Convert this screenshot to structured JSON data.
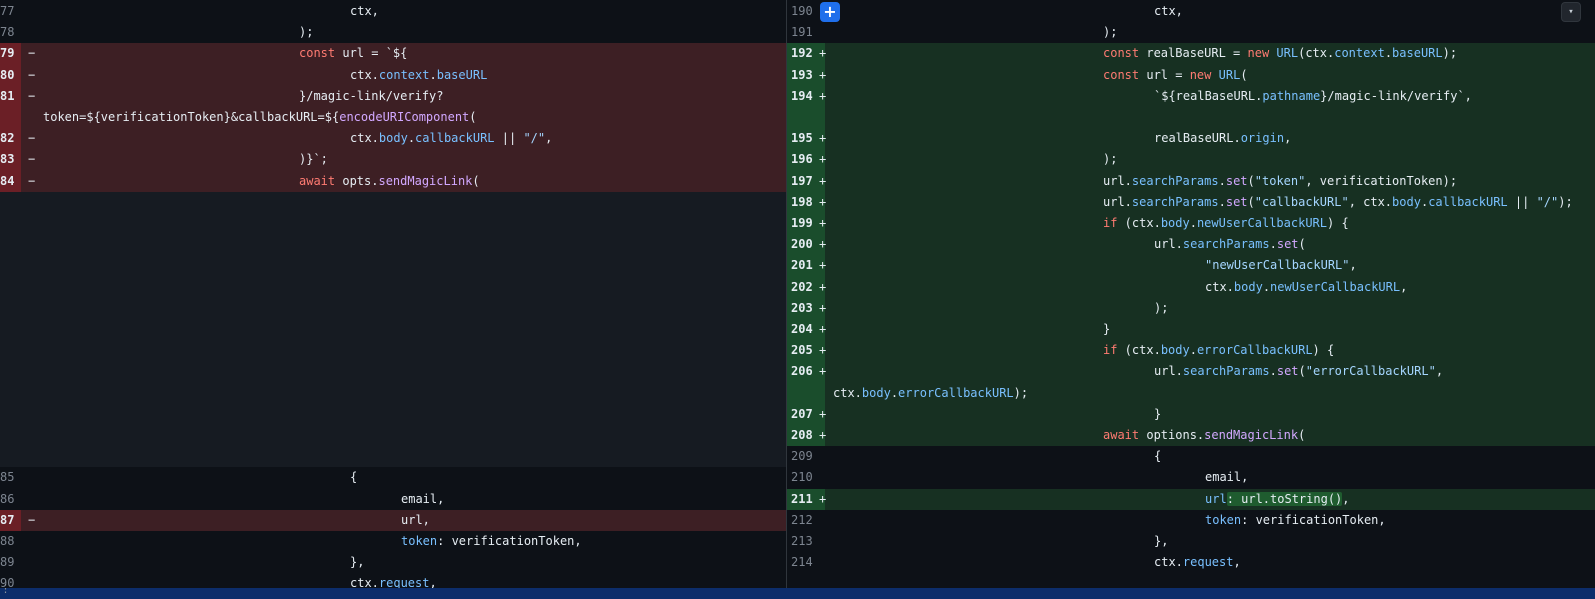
{
  "left": {
    "rows": [
      {
        "ln": "77",
        "mark": "",
        "type": "ctx",
        "indent": 350,
        "code": [
          [
            "ctx,",
            ""
          ]
        ]
      },
      {
        "ln": "78",
        "mark": "",
        "type": "ctx",
        "indent": 299,
        "code": [
          [
            ");",
            ""
          ]
        ]
      },
      {
        "ln": "79",
        "mark": "−",
        "type": "del",
        "indent": 299,
        "code": [
          [
            "const",
            "kw"
          ],
          [
            " url = `${",
            ""
          ]
        ]
      },
      {
        "ln": "80",
        "mark": "−",
        "type": "del",
        "indent": 350,
        "code": [
          [
            "ctx.",
            ""
          ],
          [
            "context",
            "pr"
          ],
          [
            ".",
            ""
          ],
          [
            "baseURL",
            "pr"
          ]
        ]
      },
      {
        "ln": "81",
        "mark": "−",
        "type": "del",
        "indent": 299,
        "code": [
          [
            "}/magic-link/verify?",
            ""
          ]
        ],
        "wrap": [
          [
            "token=${verificationToken}&callbackURL=${",
            ""
          ],
          [
            "encodeURIComponent",
            "fn"
          ],
          [
            "(",
            ""
          ]
        ]
      },
      {
        "ln": "82",
        "mark": "−",
        "type": "del",
        "indent": 350,
        "code": [
          [
            "ctx.",
            ""
          ],
          [
            "body",
            "pr"
          ],
          [
            ".",
            ""
          ],
          [
            "callbackURL",
            "pr"
          ],
          [
            " || ",
            ""
          ],
          [
            "\"/\"",
            "str"
          ],
          [
            ",",
            ""
          ]
        ]
      },
      {
        "ln": "83",
        "mark": "−",
        "type": "del",
        "indent": 299,
        "code": [
          [
            ")}`;",
            ""
          ]
        ]
      },
      {
        "ln": "84",
        "mark": "−",
        "type": "del",
        "indent": 299,
        "code": [
          [
            "await",
            "kw"
          ],
          [
            " opts.",
            ""
          ],
          [
            "sendMagicLink",
            "fn"
          ],
          [
            "(",
            ""
          ]
        ]
      },
      {
        "type": "empty",
        "span": 13
      },
      {
        "ln": "85",
        "mark": "",
        "type": "ctx",
        "indent": 350,
        "code": [
          [
            "{",
            ""
          ]
        ]
      },
      {
        "ln": "86",
        "mark": "",
        "type": "ctx",
        "indent": 401,
        "code": [
          [
            "email,",
            ""
          ]
        ]
      },
      {
        "ln": "87",
        "mark": "−",
        "type": "del",
        "indent": 401,
        "code": [
          [
            "url,",
            ""
          ]
        ]
      },
      {
        "ln": "88",
        "mark": "",
        "type": "ctx",
        "indent": 401,
        "code": [
          [
            "token",
            "pr"
          ],
          [
            ": verificationToken,",
            ""
          ]
        ]
      },
      {
        "ln": "89",
        "mark": "",
        "type": "ctx",
        "indent": 350,
        "code": [
          [
            "},",
            ""
          ]
        ]
      },
      {
        "ln": "90",
        "mark": "",
        "type": "ctx",
        "indent": 350,
        "code": [
          [
            "ctx.",
            ""
          ],
          [
            "request",
            "pr"
          ],
          [
            ",",
            ""
          ]
        ]
      }
    ]
  },
  "right": {
    "rows": [
      {
        "ln": "190",
        "mark": "",
        "type": "ctx",
        "indent": 367,
        "code": [
          [
            "ctx,",
            ""
          ]
        ]
      },
      {
        "ln": "191",
        "mark": "",
        "type": "ctx",
        "indent": 316,
        "code": [
          [
            ");",
            ""
          ]
        ]
      },
      {
        "ln": "192",
        "mark": "+",
        "type": "add",
        "indent": 316,
        "code": [
          [
            "const",
            "kw"
          ],
          [
            " realBaseURL = ",
            ""
          ],
          [
            "new",
            "kw"
          ],
          [
            " ",
            ""
          ],
          [
            "URL",
            "pr"
          ],
          [
            "(ctx.",
            ""
          ],
          [
            "context",
            "pr"
          ],
          [
            ".",
            ""
          ],
          [
            "baseURL",
            "pr"
          ],
          [
            ");",
            ""
          ]
        ]
      },
      {
        "ln": "193",
        "mark": "+",
        "type": "add",
        "indent": 316,
        "code": [
          [
            "const",
            "kw"
          ],
          [
            " url = ",
            ""
          ],
          [
            "new",
            "kw"
          ],
          [
            " ",
            ""
          ],
          [
            "URL",
            "pr"
          ],
          [
            "(",
            ""
          ]
        ]
      },
      {
        "ln": "194",
        "mark": "+",
        "type": "add",
        "indent": 367,
        "code": [
          [
            "`${realBaseURL.",
            ""
          ],
          [
            "pathname",
            "pr"
          ],
          [
            "}/magic-link/verify`,",
            ""
          ]
        ],
        "blank": true
      },
      {
        "ln": "195",
        "mark": "+",
        "type": "add",
        "indent": 367,
        "code": [
          [
            "realBaseURL.",
            ""
          ],
          [
            "origin",
            "pr"
          ],
          [
            ",",
            ""
          ]
        ]
      },
      {
        "ln": "196",
        "mark": "+",
        "type": "add",
        "indent": 316,
        "code": [
          [
            ");",
            ""
          ]
        ]
      },
      {
        "ln": "197",
        "mark": "+",
        "type": "add",
        "indent": 316,
        "code": [
          [
            "url.",
            ""
          ],
          [
            "searchParams",
            "pr"
          ],
          [
            ".",
            ""
          ],
          [
            "set",
            "fn"
          ],
          [
            "(",
            ""
          ],
          [
            "\"token\"",
            "str"
          ],
          [
            ", verificationToken);",
            ""
          ]
        ]
      },
      {
        "ln": "198",
        "mark": "+",
        "type": "add",
        "indent": 316,
        "code": [
          [
            "url.",
            ""
          ],
          [
            "searchParams",
            "pr"
          ],
          [
            ".",
            ""
          ],
          [
            "set",
            "fn"
          ],
          [
            "(",
            ""
          ],
          [
            "\"callbackURL\"",
            "str"
          ],
          [
            ", ctx.",
            ""
          ],
          [
            "body",
            "pr"
          ],
          [
            ".",
            ""
          ],
          [
            "callbackURL",
            "pr"
          ],
          [
            " || ",
            ""
          ],
          [
            "\"/\"",
            "str"
          ],
          [
            ");",
            ""
          ]
        ]
      },
      {
        "ln": "199",
        "mark": "+",
        "type": "add",
        "indent": 316,
        "code": [
          [
            "if",
            "kw"
          ],
          [
            " (ctx.",
            ""
          ],
          [
            "body",
            "pr"
          ],
          [
            ".",
            ""
          ],
          [
            "newUserCallbackURL",
            "pr"
          ],
          [
            ") {",
            ""
          ]
        ]
      },
      {
        "ln": "200",
        "mark": "+",
        "type": "add",
        "indent": 367,
        "code": [
          [
            "url.",
            ""
          ],
          [
            "searchParams",
            "pr"
          ],
          [
            ".",
            ""
          ],
          [
            "set",
            "fn"
          ],
          [
            "(",
            ""
          ]
        ]
      },
      {
        "ln": "201",
        "mark": "+",
        "type": "add",
        "indent": 418,
        "code": [
          [
            "\"newUserCallbackURL\"",
            "str"
          ],
          [
            ",",
            ""
          ]
        ]
      },
      {
        "ln": "202",
        "mark": "+",
        "type": "add",
        "indent": 418,
        "code": [
          [
            "ctx.",
            ""
          ],
          [
            "body",
            "pr"
          ],
          [
            ".",
            ""
          ],
          [
            "newUserCallbackURL",
            "pr"
          ],
          [
            ",",
            ""
          ]
        ]
      },
      {
        "ln": "203",
        "mark": "+",
        "type": "add",
        "indent": 367,
        "code": [
          [
            ");",
            ""
          ]
        ]
      },
      {
        "ln": "204",
        "mark": "+",
        "type": "add",
        "indent": 316,
        "code": [
          [
            "}",
            ""
          ]
        ]
      },
      {
        "ln": "205",
        "mark": "+",
        "type": "add",
        "indent": 316,
        "code": [
          [
            "if",
            "kw"
          ],
          [
            " (ctx.",
            ""
          ],
          [
            "body",
            "pr"
          ],
          [
            ".",
            ""
          ],
          [
            "errorCallbackURL",
            "pr"
          ],
          [
            ") {",
            ""
          ]
        ]
      },
      {
        "ln": "206",
        "mark": "+",
        "type": "add",
        "indent": 367,
        "code": [
          [
            "url.",
            ""
          ],
          [
            "searchParams",
            "pr"
          ],
          [
            ".",
            ""
          ],
          [
            "set",
            "fn"
          ],
          [
            "(",
            ""
          ],
          [
            "\"errorCallbackURL\"",
            "str"
          ],
          [
            ",",
            ""
          ]
        ],
        "wrap": [
          [
            "ctx.",
            ""
          ],
          [
            "body",
            "pr"
          ],
          [
            ".",
            ""
          ],
          [
            "errorCallbackURL",
            "pr"
          ],
          [
            ");",
            ""
          ]
        ]
      },
      {
        "ln": "207",
        "mark": "+",
        "type": "add",
        "indent": 367,
        "code": [
          [
            "}",
            ""
          ]
        ]
      },
      {
        "ln": "208",
        "mark": "+",
        "type": "add",
        "indent": 316,
        "code": [
          [
            "await",
            "kw"
          ],
          [
            " options.",
            ""
          ],
          [
            "sendMagicLink",
            "fn"
          ],
          [
            "(",
            ""
          ]
        ]
      },
      {
        "ln": "209",
        "mark": "",
        "type": "ctx",
        "indent": 367,
        "code": [
          [
            "{",
            ""
          ]
        ]
      },
      {
        "ln": "210",
        "mark": "",
        "type": "ctx",
        "indent": 418,
        "code": [
          [
            "email,",
            ""
          ]
        ]
      },
      {
        "ln": "211",
        "mark": "+",
        "type": "add",
        "indent": 418,
        "code": [
          [
            "url",
            "pr"
          ],
          [
            ": url.toString()",
            "hl"
          ],
          [
            ",",
            ""
          ]
        ]
      },
      {
        "ln": "212",
        "mark": "",
        "type": "ctx",
        "indent": 418,
        "code": [
          [
            "token",
            "pr"
          ],
          [
            ": verificationToken,",
            ""
          ]
        ]
      },
      {
        "ln": "213",
        "mark": "",
        "type": "ctx",
        "indent": 367,
        "code": [
          [
            "},",
            ""
          ]
        ]
      },
      {
        "ln": "214",
        "mark": "",
        "type": "ctx",
        "indent": 367,
        "code": [
          [
            "ctx.",
            ""
          ],
          [
            "request",
            "pr"
          ],
          [
            ",",
            ""
          ]
        ]
      }
    ]
  },
  "expand_button": "+",
  "menu_icon": "▾",
  "bottom_bar_text": "⋮"
}
